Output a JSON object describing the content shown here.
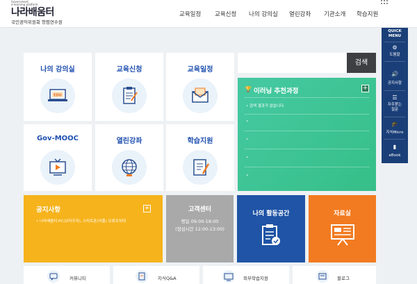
{
  "brand": {
    "sub1": "Government",
    "sub2": "e-learning platform",
    "name": "나라배움터",
    "org": "국민권익위원회 청렴연수원"
  },
  "nav": [
    "교육일정",
    "교육신청",
    "나의 강의실",
    "열린강좌",
    "기관소개",
    "학습지원"
  ],
  "tiles": [
    {
      "label": "나의 강의실",
      "icon": "edu-laptop-icon"
    },
    {
      "label": "교육신청",
      "icon": "clipboard-icon"
    },
    {
      "label": "교육일정",
      "icon": "envelope-icon"
    },
    {
      "label": "Gov-MOOC",
      "icon": "tv-play-icon"
    },
    {
      "label": "열린강좌",
      "icon": "globe-icon"
    },
    {
      "label": "학습지원",
      "icon": "notebook-icon"
    }
  ],
  "search": {
    "button": "검색",
    "placeholder": ""
  },
  "recommend": {
    "title": "이러닝 추천과정",
    "empty": "검색 결과가 없습니다.",
    "bullet": "•"
  },
  "notice": {
    "title": "공지사항",
    "item": "나라배움터 PC(브라우저), 스마트폰(어플) 오류조치대"
  },
  "service": {
    "title": "고객센터",
    "line1": "평일 09:00-18:00",
    "line2": "(점심시간 12:00-13:00)"
  },
  "activity": {
    "title": "나의 활동공간"
  },
  "resource": {
    "title": "자료실"
  },
  "bottom": [
    "커뮤니티",
    "지식Q&A",
    "외부학습지원",
    "블로그"
  ],
  "quick": {
    "head1": "QUICK",
    "head2": "MENU",
    "items": [
      "도움말",
      "공지사항",
      "자주묻는\n질문",
      "지식Micro",
      "eBook"
    ]
  },
  "colors": {
    "primary": "#1e4fb0",
    "green": "#3cc595",
    "yellow": "#f6b31c",
    "gray": "#a9a9a9",
    "navy": "#1f54a6",
    "orange": "#f27b21"
  }
}
